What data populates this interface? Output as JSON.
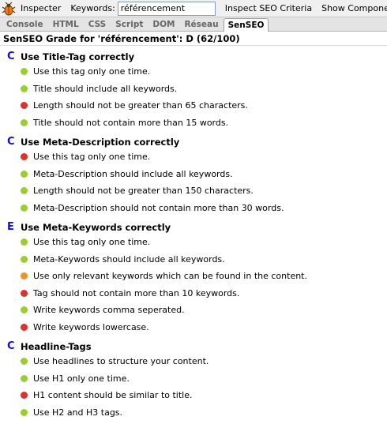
{
  "colors": {
    "green": "#9acd32",
    "red": "#d9342b",
    "orange": "#f0922a",
    "grade": "#1010cc"
  },
  "toolbar": {
    "inspect_label": "Inspecter",
    "keywords_label": "Keywords:",
    "keywords_value": "référencement",
    "inspect_seo_label": "Inspect SEO Criteria",
    "show_components_label": "Show Components"
  },
  "tabs": [
    "Console",
    "HTML",
    "CSS",
    "Script",
    "DOM",
    "Réseau",
    "SenSEO"
  ],
  "active_tab": "SenSEO",
  "grade_header": "SenSEO Grade for 'référencement': D (62/100)",
  "sections": [
    {
      "grade": "C",
      "title": "Use Title-Tag correctly",
      "items": [
        {
          "text": "Use this tag only one time.",
          "status": "green"
        },
        {
          "text": "Title should include all keywords.",
          "status": "green"
        },
        {
          "text": "Length should not be greater than 65 characters.",
          "status": "red"
        },
        {
          "text": "Title should not contain more than 15 words.",
          "status": "green"
        }
      ]
    },
    {
      "grade": "C",
      "title": "Use Meta-Description correctly",
      "items": [
        {
          "text": "Use this tag only one time.",
          "status": "red"
        },
        {
          "text": "Meta-Description should include all keywords.",
          "status": "green"
        },
        {
          "text": "Length should not be greater than 150 characters.",
          "status": "green"
        },
        {
          "text": "Meta-Description should not contain more than 30 words.",
          "status": "green"
        }
      ]
    },
    {
      "grade": "E",
      "title": "Use Meta-Keywords correctly",
      "items": [
        {
          "text": "Use this tag only one time.",
          "status": "green"
        },
        {
          "text": "Meta-Keywords should include all keywords.",
          "status": "green"
        },
        {
          "text": "Use only relevant keywords which can be found in the content.",
          "status": "orange"
        },
        {
          "text": "Tag should not contain more than 10 keywords.",
          "status": "red"
        },
        {
          "text": "Write keywords comma seperated.",
          "status": "green"
        },
        {
          "text": "Write keywords lowercase.",
          "status": "red"
        }
      ]
    },
    {
      "grade": "C",
      "title": "Headline-Tags",
      "items": [
        {
          "text": "Use headlines to structure your content.",
          "status": "green"
        },
        {
          "text": "Use H1 only one time.",
          "status": "green"
        },
        {
          "text": "H1 content should be similar to title.",
          "status": "red"
        },
        {
          "text": "Use H2 and H3 tags.",
          "status": "green"
        }
      ]
    }
  ]
}
